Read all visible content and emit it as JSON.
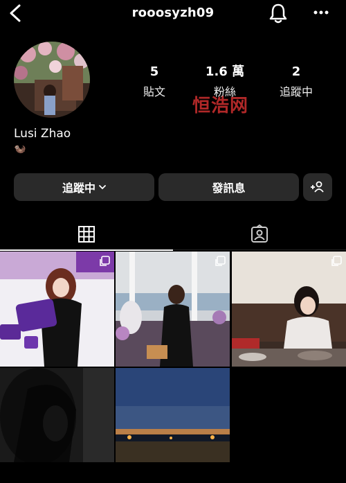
{
  "header": {
    "username": "rooosyzh09",
    "icons": [
      "back-arrow-icon",
      "bell-icon",
      "more-icon"
    ]
  },
  "profile": {
    "stats": [
      {
        "value": "5",
        "label": "貼文"
      },
      {
        "value": "1.6 萬",
        "label": "粉絲"
      },
      {
        "value": "2",
        "label": "追蹤中"
      }
    ],
    "display_name": "Lusi Zhao",
    "bio_icon": "🦦",
    "watermark": "恒浩网"
  },
  "actions": {
    "following_label": "追蹤中",
    "message_label": "發訊息",
    "add_icon": "add-person-icon"
  },
  "tabs": [
    {
      "name": "grid-tab",
      "icon": "grid-icon"
    },
    {
      "name": "tagged-tab",
      "icon": "tagged-person-icon"
    }
  ],
  "colors": {
    "background": "#000000",
    "button": "#2a2a2a",
    "watermark": "#d33333"
  }
}
